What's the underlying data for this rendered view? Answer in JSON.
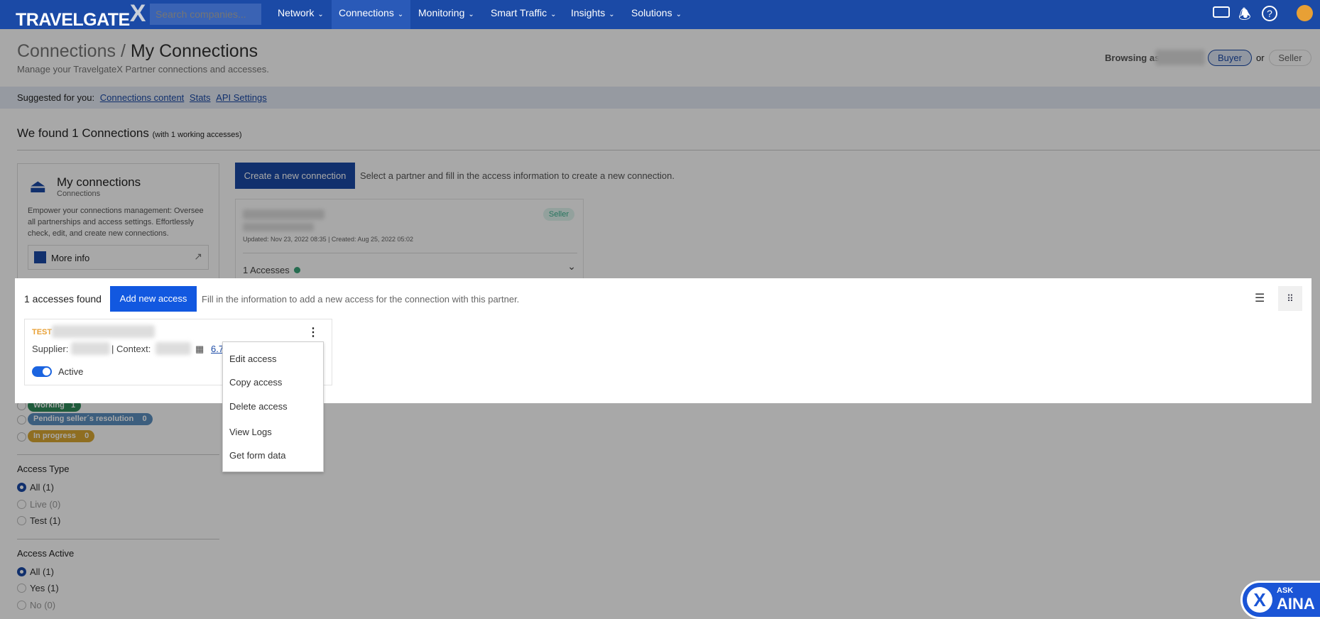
{
  "nav": {
    "logo": "TRAVELGATE",
    "logo_x": "X",
    "search_placeholder": "Search companies...",
    "items": [
      {
        "label": "Network"
      },
      {
        "label": "Connections"
      },
      {
        "label": "Monitoring"
      },
      {
        "label": "Smart Traffic"
      },
      {
        "label": "Insights"
      },
      {
        "label": "Solutions"
      }
    ],
    "active": "Connections",
    "icons": [
      "ticket-icon",
      "bell-icon",
      "help-icon",
      "avatar"
    ]
  },
  "header": {
    "parent": "Connections",
    "sep": "/",
    "title": "My Connections",
    "subtitle": "Manage your TravelgateX Partner connections and accesses.",
    "browsing_as": "Browsing as",
    "buyer": "Buyer",
    "or": "or",
    "seller": "Seller"
  },
  "suggested": {
    "label": "Suggested for you:",
    "links": [
      "Connections content",
      "Stats",
      "API Settings"
    ]
  },
  "found": {
    "text": "We found 1 Connections",
    "detail": "(with 1 working accesses)"
  },
  "info_card": {
    "title": "My connections",
    "subtitle": "Connections",
    "description": "Empower your connections management: Oversee all partnerships and access settings. Effortlessly check, edit, and create new connections.",
    "more_info": "More info"
  },
  "create": {
    "button": "Create a new connection",
    "hint": "Select a partner and fill in the access information to create a new connection."
  },
  "connection": {
    "badge": "Seller",
    "dates": "Updated: Nov 23, 2022 08:35 | Created: Aug 25, 2022 05:02",
    "accesses": "1 Accesses",
    "status_color": "#3aa57a"
  },
  "accesses": {
    "count": "1 accesses found",
    "add_button": "Add new access",
    "hint": "Fill in the information to add a new access for the connection with this partner.",
    "card": {
      "tag": "TEST",
      "supplier": "Supplier:",
      "context": "| Context:",
      "link": "6.7",
      "active": "Active"
    }
  },
  "menu": [
    "Edit access",
    "Copy access",
    "Delete access",
    "View Logs",
    "Get form data"
  ],
  "filters": {
    "status": [
      {
        "label": "Working",
        "count": "1",
        "color": "#2f8a5a"
      },
      {
        "label": "Pending seller´s resolution",
        "count": "0",
        "color": "#5b8fbf"
      },
      {
        "label": "In progress",
        "count": "0",
        "color": "#d9a832"
      }
    ],
    "access_type": {
      "title": "Access Type",
      "options": [
        "All (1)",
        "Live (0)",
        "Test (1)"
      ]
    },
    "access_active": {
      "title": "Access Active",
      "options": [
        "All (1)",
        "Yes (1)",
        "No (0)"
      ]
    }
  },
  "aina": {
    "ask": "ASK",
    "name": "AINA"
  }
}
